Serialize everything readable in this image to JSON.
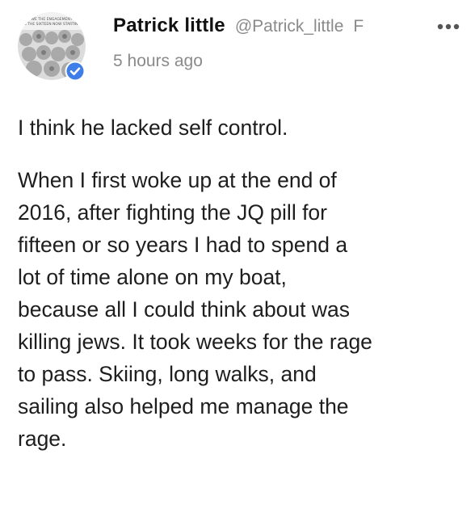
{
  "post": {
    "author": {
      "display_name": "Patrick little",
      "handle": "@Patrick_little",
      "follow_initial": "F",
      "verified": true,
      "avatar_caption_lines": [
        "WE THE ENGAGEMENT",
        "IN THE SIXTEEN NOW STARTING"
      ]
    },
    "timestamp": "5 hours ago",
    "paragraphs": [
      {
        "lines": [
          "I think he lacked self control."
        ]
      },
      {
        "lines": [
          "When I first woke up at the end of",
          "2016, after fighting the JQ pill for",
          "fifteen or so years I had to spend a",
          "lot of time alone on my boat,",
          "because all I could think about was",
          "killing jews. It took weeks for the rage",
          "to pass. Skiing, long walks, and",
          "sailing also helped me manage the",
          "rage."
        ]
      }
    ]
  },
  "colors": {
    "name": "#111111",
    "meta": "#8a8a8a",
    "text": "#1e1e1e",
    "verified": "#3f7ee8"
  },
  "icons": {
    "more": "more-horizontal-icon",
    "verified": "verified-check-icon"
  }
}
